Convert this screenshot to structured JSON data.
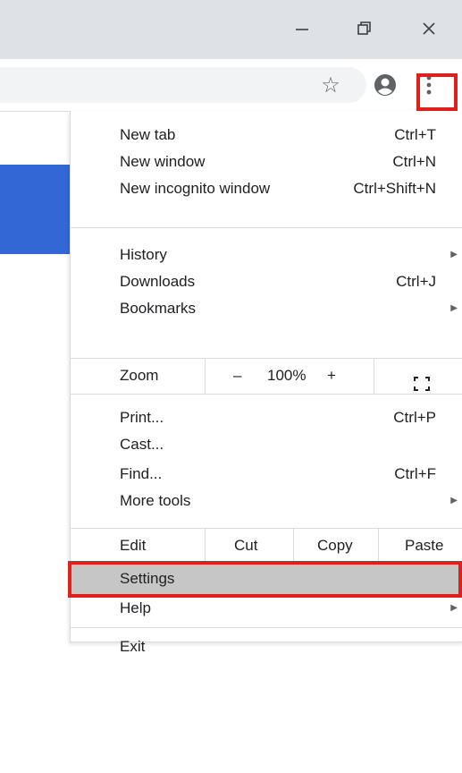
{
  "window": {
    "minimize_icon": "minimize-icon",
    "restore_icon": "restore-icon",
    "close_icon": "close-icon"
  },
  "toolbar": {
    "bookmark_icon": "star-icon",
    "profile_icon": "account-icon",
    "menu_icon": "three-dot-menu-icon"
  },
  "menu": {
    "group1": [
      {
        "label": "New tab",
        "shortcut": "Ctrl+T"
      },
      {
        "label": "New window",
        "shortcut": "Ctrl+N"
      },
      {
        "label": "New incognito window",
        "shortcut": "Ctrl+Shift+N"
      }
    ],
    "group2": [
      {
        "label": "History",
        "submenu": true
      },
      {
        "label": "Downloads",
        "shortcut": "Ctrl+J"
      },
      {
        "label": "Bookmarks",
        "submenu": true
      }
    ],
    "zoom": {
      "label": "Zoom",
      "minus": "–",
      "value": "100%",
      "plus": "+",
      "fullscreen_icon": "fullscreen-icon"
    },
    "group3": [
      {
        "label": "Print...",
        "shortcut": "Ctrl+P"
      },
      {
        "label": "Cast..."
      },
      {
        "label": "Find...",
        "shortcut": "Ctrl+F"
      },
      {
        "label": "More tools",
        "submenu": true
      }
    ],
    "edit": {
      "label": "Edit",
      "cut": "Cut",
      "copy": "Copy",
      "paste": "Paste"
    },
    "group4": [
      {
        "label": "Settings"
      },
      {
        "label": "Help",
        "submenu": true
      }
    ],
    "exit": {
      "label": "Exit"
    }
  },
  "colors": {
    "highlight_box": "#e0201b",
    "selected_row": "#c6c6c6",
    "page_accent": "#3367d6"
  }
}
